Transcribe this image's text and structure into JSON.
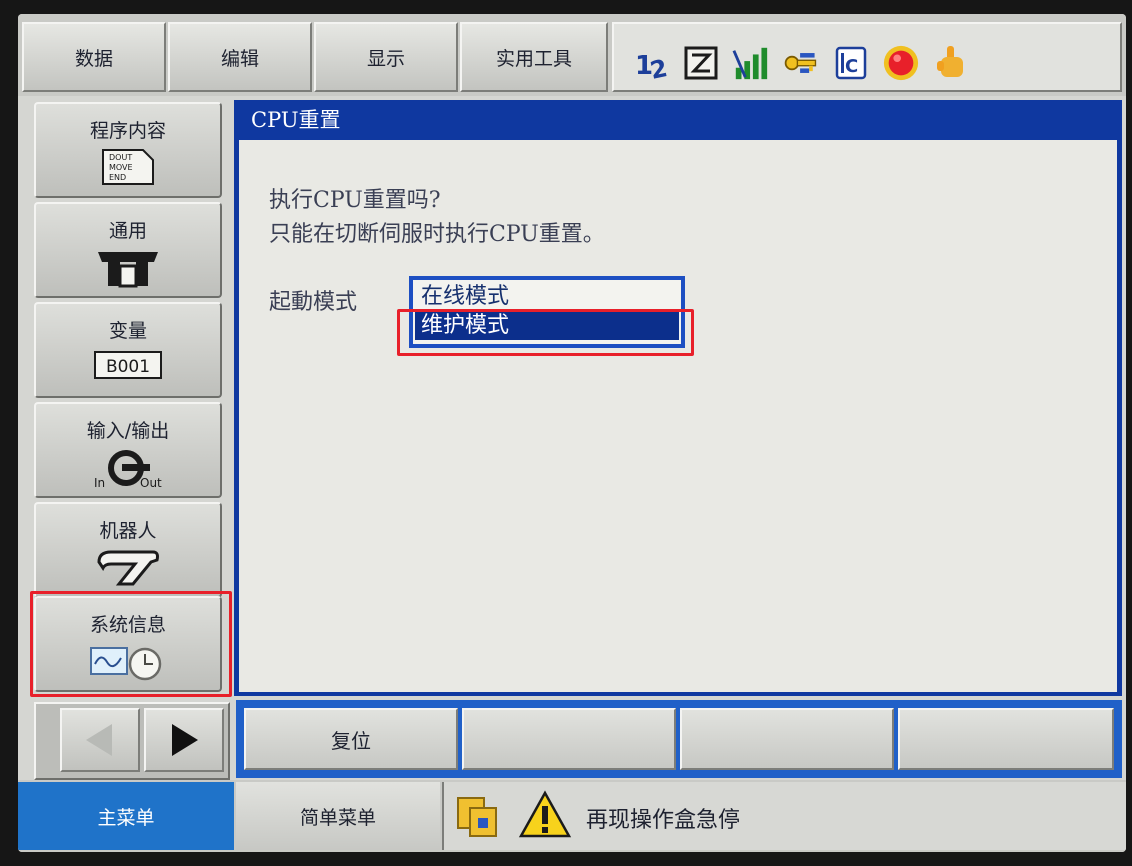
{
  "top_menu": [
    "数据",
    "编辑",
    "显示",
    "实用工具"
  ],
  "status_icons": [
    "coordinate-icon",
    "edit-mode-icon",
    "signal-icon",
    "key-icon",
    "info-icon",
    "servo-on-icon",
    "hand-icon"
  ],
  "top_icon_text": {
    "coord": "1",
    "coord_sub": "2",
    "info": "C"
  },
  "side_nav": [
    {
      "label": "程序内容",
      "icon": "program-icon",
      "icon_lines": [
        "DOUT",
        "MOVE",
        "END"
      ]
    },
    {
      "label": "通用",
      "icon": "general-icon"
    },
    {
      "label": "变量",
      "icon": "variable-icon",
      "icon_text": "B001"
    },
    {
      "label": "输入/输出",
      "icon": "io-icon",
      "in": "In",
      "out": "Out"
    },
    {
      "label": "机器人",
      "icon": "robot-icon"
    },
    {
      "label": "系统信息",
      "icon": "system-info-icon"
    }
  ],
  "window": {
    "title": "CPU重置",
    "line1": "执行CPU重置吗?",
    "line2": "只能在切断伺服时执行CPU重置。",
    "mode_label": "起動模式",
    "options": [
      "在线模式",
      "维护模式"
    ],
    "selected": "维护模式"
  },
  "function_keys": [
    "复位",
    "",
    "",
    ""
  ],
  "bottom": {
    "main_menu": "主菜单",
    "simple_menu": "简单菜单",
    "status_message": "再现操作盒急停"
  },
  "colors": {
    "title_bar": "#0f38a0",
    "selection": "#0c2f8c",
    "main_menu_bg": "#1f73c9",
    "highlight": "#e8202a",
    "servo_lamp": "#e8202a"
  }
}
